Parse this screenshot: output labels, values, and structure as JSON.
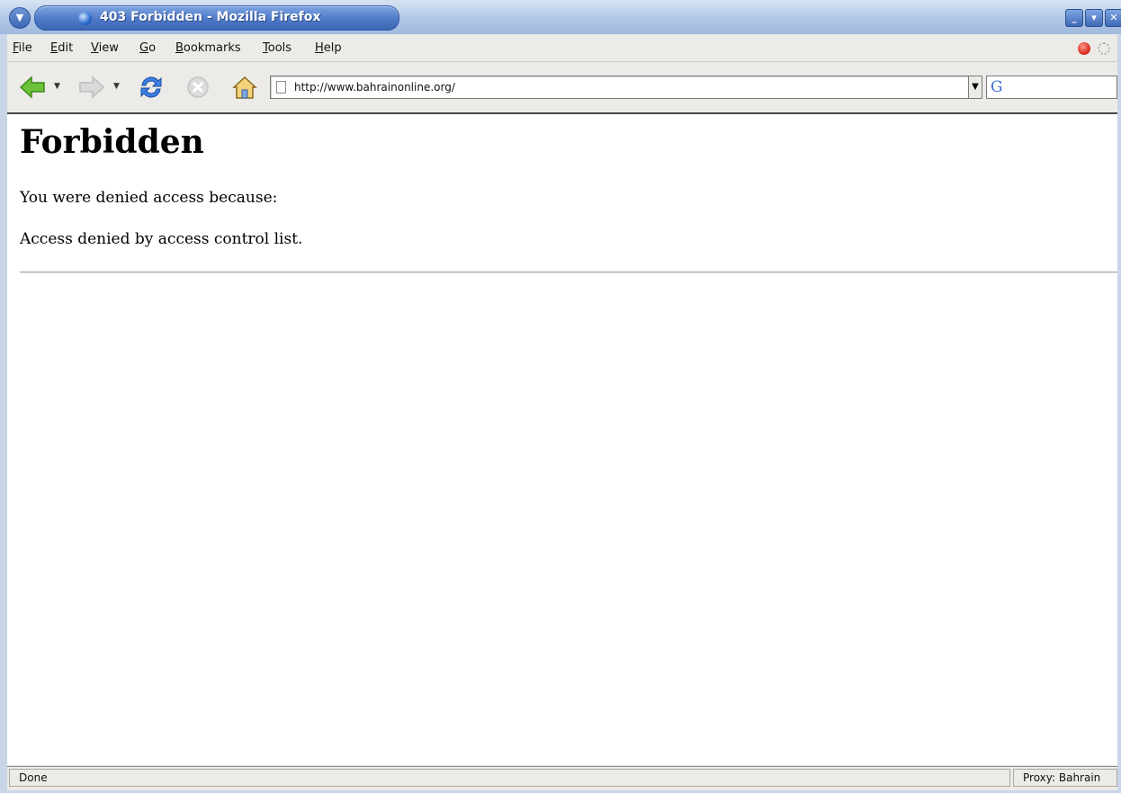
{
  "window": {
    "title": "403 Forbidden - Mozilla Firefox",
    "wm_menu_icon": "chevron-down-icon",
    "controls": {
      "minimize": "_",
      "maximize": "▾",
      "close": "✕"
    }
  },
  "menubar": {
    "items": [
      {
        "label": "File",
        "accel": "F"
      },
      {
        "label": "Edit",
        "accel": "E"
      },
      {
        "label": "View",
        "accel": "V"
      },
      {
        "label": "Go",
        "accel": "G"
      },
      {
        "label": "Bookmarks",
        "accel": "B"
      },
      {
        "label": "Tools",
        "accel": "T"
      },
      {
        "label": "Help",
        "accel": "H"
      }
    ]
  },
  "toolbar": {
    "back_icon": "back-arrow-icon",
    "forward_icon": "forward-arrow-icon",
    "reload_icon": "reload-icon",
    "stop_icon": "stop-icon",
    "home_icon": "home-icon",
    "url": "http://www.bahrainonline.org/",
    "search_engine": "G",
    "search_value": ""
  },
  "page": {
    "heading": "Forbidden",
    "line1": "You were denied access because:",
    "line2": "Access denied by access control list."
  },
  "statusbar": {
    "status": "Done",
    "proxy": "Proxy: Bahrain"
  },
  "colors": {
    "titlebar": "#4d79c6",
    "chrome": "#ecebe7",
    "back_arrow": "#58b528",
    "reload": "#2e6fd1"
  }
}
